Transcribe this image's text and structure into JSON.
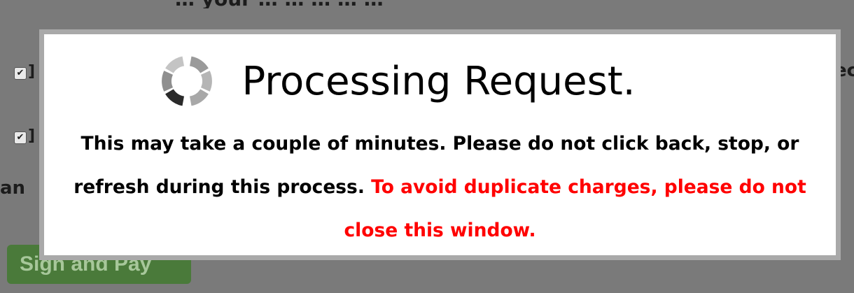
{
  "background": {
    "top_text": "… your … … … … …",
    "side_text_left": "an",
    "side_text_right": "ec",
    "sign_button_label": "Sign and Pay"
  },
  "modal": {
    "title": "Processing Request.",
    "message_normal": "This may take a couple of minutes. Please do not click back, stop, or refresh during this process.",
    "message_warning": "To avoid duplicate charges, please do not close this window."
  },
  "colors": {
    "overlay": "#7a7a7a",
    "modal_border": "#a9a9a9",
    "warning_text": "#ff0000",
    "button_green": "#4a7a3a"
  }
}
